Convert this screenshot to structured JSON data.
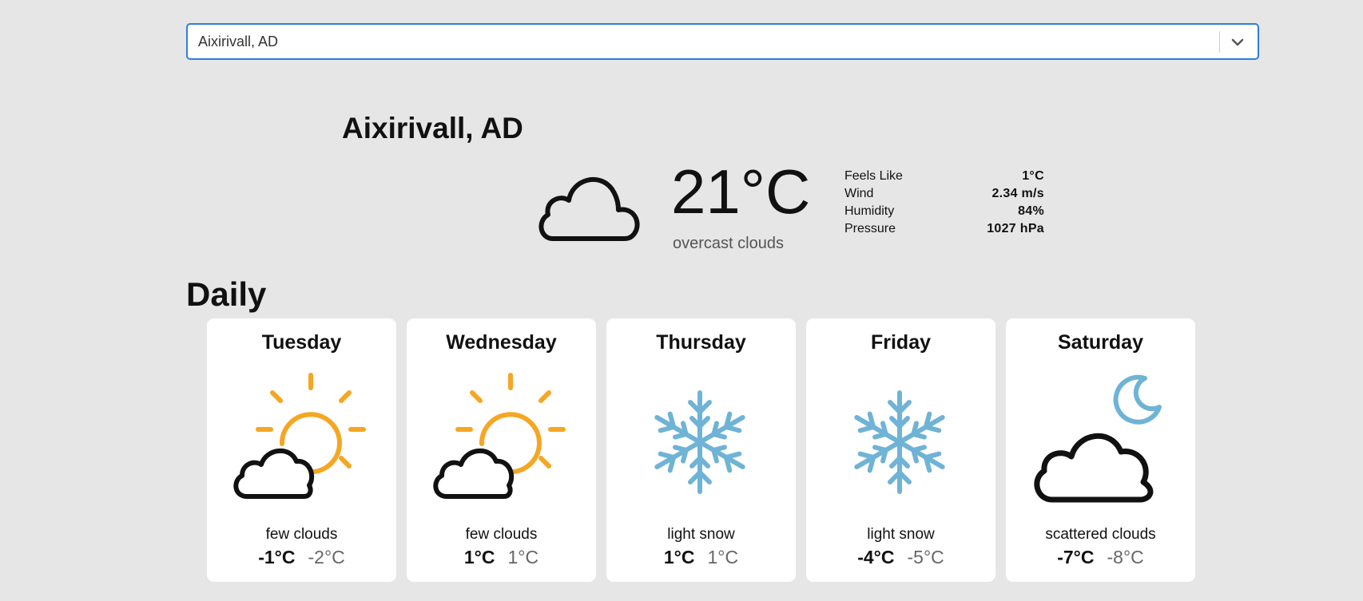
{
  "search": {
    "selected": "Aixirivall, AD"
  },
  "current": {
    "city": "Aixirivall, AD",
    "temperature": "21°C",
    "description": "overcast clouds",
    "icon": "cloud-icon",
    "details": [
      {
        "label": "Feels Like",
        "value": "1°C"
      },
      {
        "label": "Wind",
        "value": "2.34 m/s"
      },
      {
        "label": "Humidity",
        "value": "84%"
      },
      {
        "label": "Pressure",
        "value": "1027 hPa"
      }
    ]
  },
  "daily": {
    "title": "Daily",
    "days": [
      {
        "day": "Tuesday",
        "icon": "sun-cloud-icon",
        "description": "few clouds",
        "max": "-1°C",
        "min": "-2°C"
      },
      {
        "day": "Wednesday",
        "icon": "sun-cloud-icon",
        "description": "few clouds",
        "max": "1°C",
        "min": "1°C"
      },
      {
        "day": "Thursday",
        "icon": "snowflake-icon",
        "description": "light snow",
        "max": "1°C",
        "min": "1°C"
      },
      {
        "day": "Friday",
        "icon": "snowflake-icon",
        "description": "light snow",
        "max": "-4°C",
        "min": "-5°C"
      },
      {
        "day": "Saturday",
        "icon": "moon-cloud-icon",
        "description": "scattered clouds",
        "max": "-7°C",
        "min": "-8°C"
      }
    ]
  },
  "colors": {
    "accent": "#2f7de1",
    "sun": "#f5a623",
    "snow": "#6fb3d6",
    "background": "#e6e6e6"
  }
}
